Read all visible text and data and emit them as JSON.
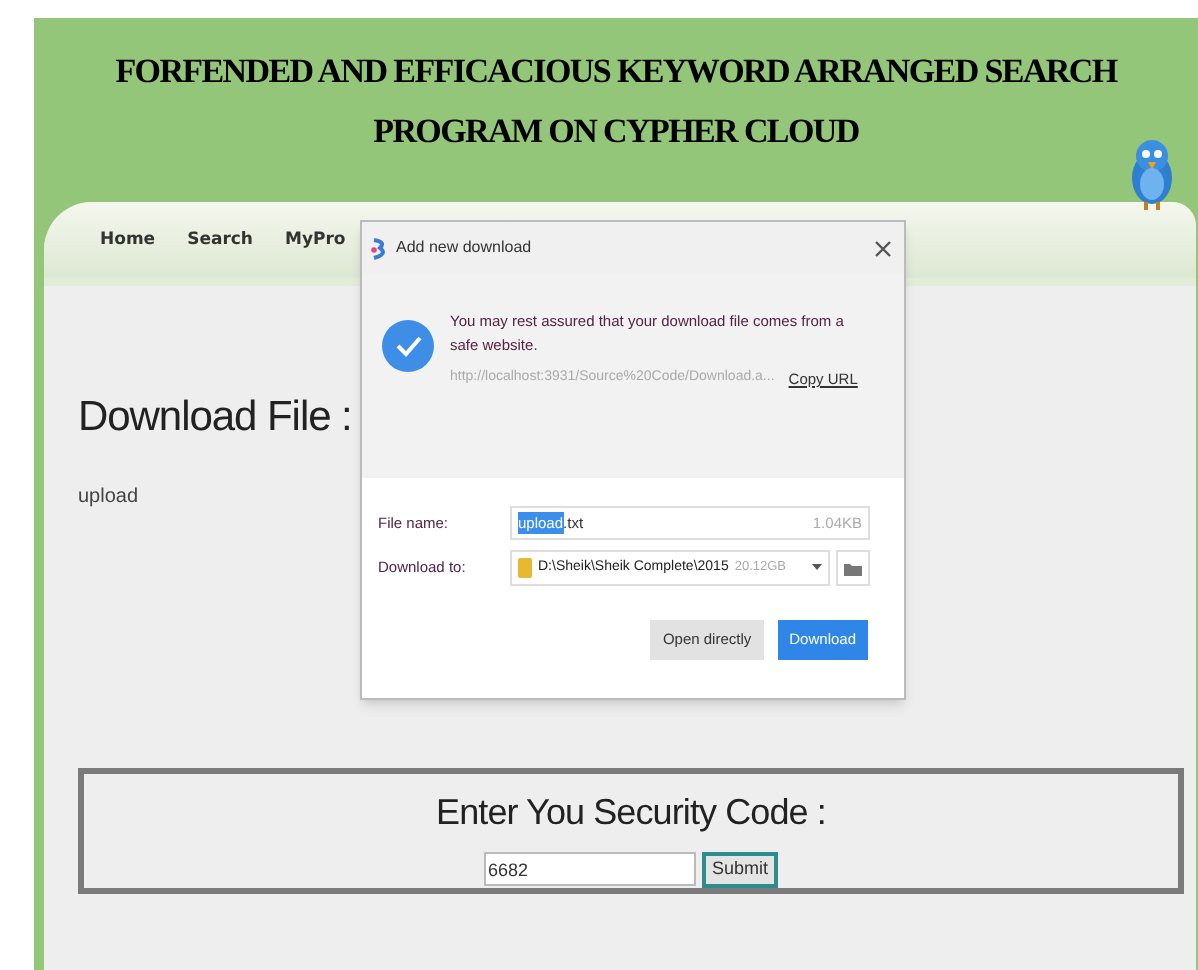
{
  "header": {
    "title_lines": [
      "FORFENDED AND EFFICACIOUS KEYWORD ARRANGED SEARCH",
      "PROGRAM ON CYPHER CLOUD"
    ]
  },
  "nav": [
    {
      "label": "Home"
    },
    {
      "label": "Search"
    },
    {
      "label": "MyPro"
    }
  ],
  "page": {
    "heading": "Download File :",
    "file_link": "upload"
  },
  "security": {
    "label": "Enter You Security Code :",
    "code": "6682",
    "submit": "Submit"
  },
  "dialog": {
    "title": "Add new download",
    "message": "You may rest assured that your download file comes from a safe website.",
    "url": "http://localhost:3931/Source%20Code/Download.a...",
    "copy_url": "Copy URL",
    "file_name_label": "File name:",
    "file_name_selected": "upload",
    "file_name_rest": ".txt",
    "file_size": "1.04KB",
    "download_to_label": "Download to:",
    "folder": "D:\\Sheik\\Sheik Complete\\2015",
    "free_space": "20.12GB",
    "buttons": [
      {
        "label": "Open directly",
        "primary": false
      },
      {
        "label": "Download",
        "primary": true
      }
    ]
  }
}
